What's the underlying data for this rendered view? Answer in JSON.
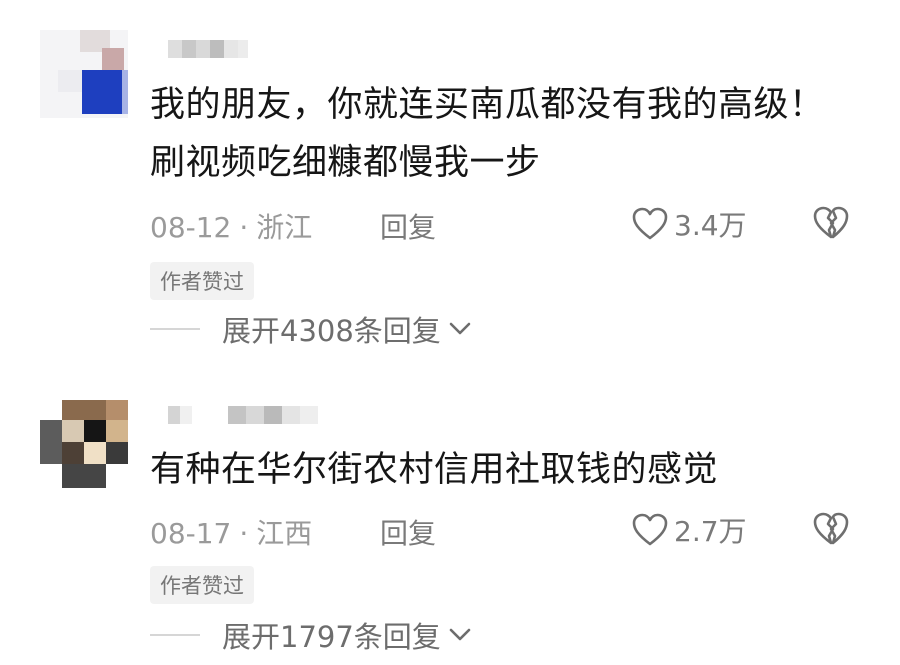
{
  "comments": [
    {
      "text_lines": [
        "我的朋友，你就连买南瓜都没有我的高级！",
        "刷视频吃细糠都慢我一步"
      ],
      "date": "08-12",
      "location": "浙江",
      "separator": "·",
      "reply_label": "回复",
      "like_count": "3.4万",
      "badge": "作者赞过",
      "expand_label": "展开4308条回复"
    },
    {
      "text_lines": [
        "有种在华尔街农村信用社取钱的感觉"
      ],
      "date": "08-17",
      "location": "江西",
      "separator": "·",
      "reply_label": "回复",
      "like_count": "2.7万",
      "badge": "作者赞过",
      "expand_label": "展开1797条回复"
    }
  ],
  "icons": {
    "like": "heart-outline-icon",
    "dislike": "broken-heart-icon",
    "expand": "chevron-down-icon"
  },
  "colors": {
    "text": "#161616",
    "meta": "#9a9a9a",
    "badge_bg": "#f2f2f2"
  }
}
